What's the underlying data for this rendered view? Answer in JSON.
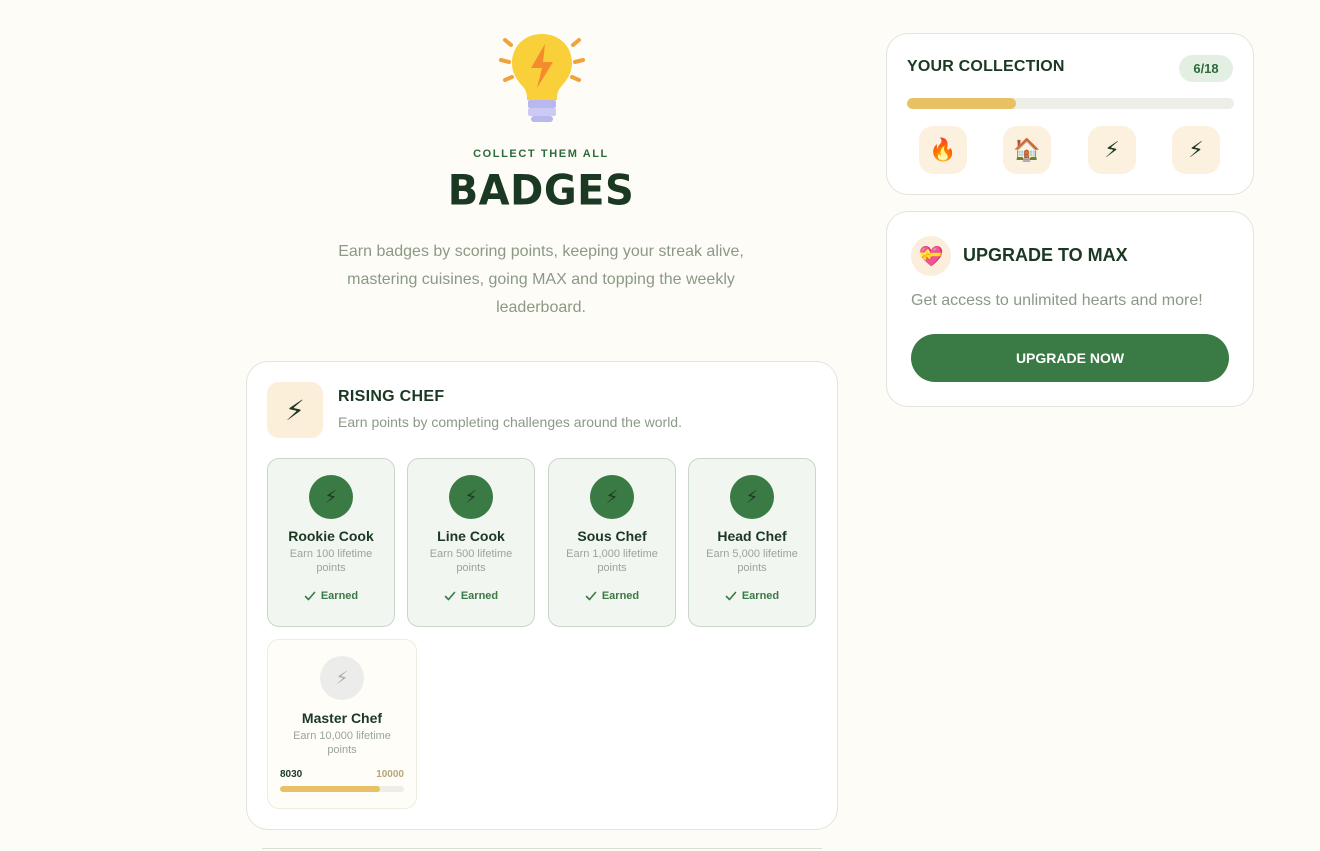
{
  "hero": {
    "icon": "lightbulb-icon",
    "eyebrow": "COLLECT THEM ALL",
    "title": "BADGES",
    "subtitle": "Earn badges by scoring points, keeping your streak alive, mastering cuisines, going MAX and topping the weekly leaderboard."
  },
  "category": {
    "icon": "lightning-icon",
    "title": "RISING CHEF",
    "description": "Earn points by completing challenges around the world.",
    "badges": [
      {
        "name": "Rookie Cook",
        "description": "Earn 100 lifetime points",
        "status": "Earned"
      },
      {
        "name": "Line Cook",
        "description": "Earn 500 lifetime points",
        "status": "Earned"
      },
      {
        "name": "Sous Chef",
        "description": "Earn 1,000 lifetime points",
        "status": "Earned"
      },
      {
        "name": "Head Chef",
        "description": "Earn 5,000 lifetime points",
        "status": "Earned"
      }
    ],
    "locked_badge": {
      "name": "Master Chef",
      "description": "Earn 10,000 lifetime points",
      "current": "8030",
      "target": "10000",
      "progress_fraction": 0.803
    }
  },
  "collection": {
    "title": "YOUR COLLECTION",
    "count": "6/18",
    "progress_fraction": 0.333,
    "icons": [
      "🔥",
      "🏠",
      "⚡",
      "⚡"
    ],
    "icon_names": [
      "fire-icon",
      "house-icon",
      "lightning-icon",
      "lightning-icon"
    ]
  },
  "upgrade": {
    "icon": "heart-gift-icon",
    "title": "UPGRADE TO MAX",
    "subtitle": "Get access to unlimited hearts and more!",
    "button_label": "UPGRADE NOW"
  },
  "colors": {
    "background": "#fefcf6",
    "primary_green": "#3a7a45",
    "dark_text": "#1b3823",
    "accent_gold": "#e8c164"
  }
}
